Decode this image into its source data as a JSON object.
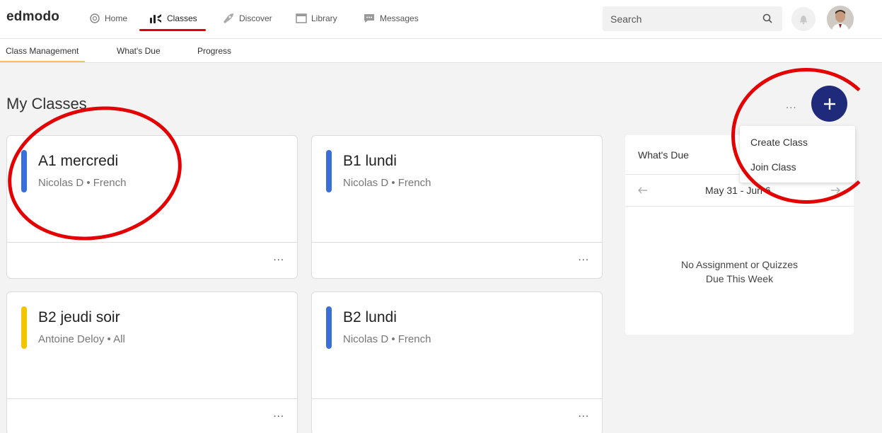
{
  "logo": "edmodo",
  "nav": {
    "home": "Home",
    "classes": "Classes",
    "discover": "Discover",
    "library": "Library",
    "messages": "Messages"
  },
  "search": {
    "placeholder": "Search"
  },
  "subnav": {
    "class_management": "Class Management",
    "whats_due": "What's Due",
    "progress": "Progress"
  },
  "page_title": "My Classes",
  "classes": [
    {
      "name": "A1 mercredi",
      "meta": "Nicolas D • French",
      "color": "#3a6fd8"
    },
    {
      "name": "B1 lundi",
      "meta": "Nicolas D • French",
      "color": "#3a6fd8"
    },
    {
      "name": "B2 jeudi soir",
      "meta": "Antoine Deloy • All",
      "color": "#f5c400"
    },
    {
      "name": "B2 lundi",
      "meta": "Nicolas D • French",
      "color": "#3a6fd8"
    }
  ],
  "card_menu": "...",
  "more_menu": "...",
  "add_button": "+",
  "dropdown": {
    "create": "Create Class",
    "join": "Join Class"
  },
  "whats_due": {
    "title": "What's Due",
    "range": "May 31 - Jun 6",
    "empty_line1": "No Assignment or Quizzes",
    "empty_line2": "Due This Week"
  },
  "colors": {
    "accent": "#1f2a7a",
    "annotation": "#e40000",
    "active_nav": "#e00000"
  }
}
